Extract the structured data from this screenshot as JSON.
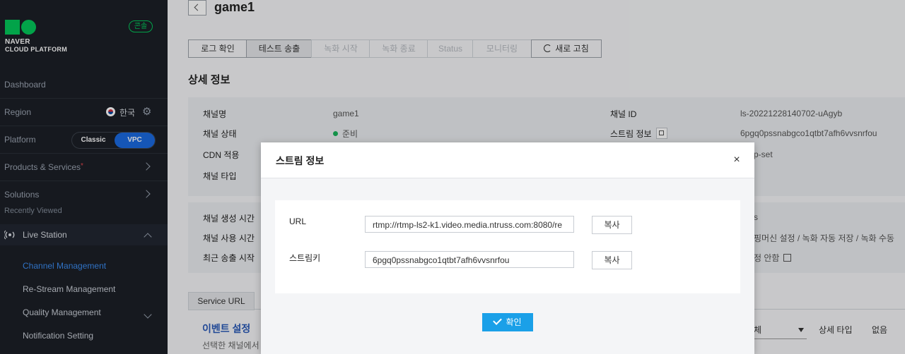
{
  "sidebar": {
    "logo_line1": "NAVER",
    "logo_line2": "CLOUD PLATFORM",
    "console_badge": "콘솔",
    "dashboard": "Dashboard",
    "region_label": "Region",
    "region_value": "한국",
    "platform_label": "Platform",
    "platform_classic": "Classic",
    "platform_vpc": "VPC",
    "products_services": "Products & Services",
    "solutions": "Solutions",
    "recently_viewed": "Recently Viewed",
    "live_station": "Live Station",
    "sub_items": [
      "Channel Management",
      "Re-Stream Management",
      "Quality Management",
      "Notification Setting"
    ]
  },
  "header": {
    "title": "game1"
  },
  "toolbar": {
    "buttons": [
      "로그 확인",
      "테스트 송출",
      "녹화 시작",
      "녹화 종료",
      "Status",
      "모니터링"
    ],
    "refresh": "새로 고침"
  },
  "detail": {
    "section_title": "상세 정보",
    "labels": [
      "채널명",
      "채널 상태",
      "CDN 적용",
      "채널 타입"
    ],
    "channel_name": "game1",
    "channel_status": "준비",
    "right_labels": [
      "채널 ID",
      "스트림 정보"
    ],
    "channel_id": "ls-20221228140702-uAgyb",
    "stream_info": "6pgq0pssnabgco1qtbt7afh6vvsnrfou",
    "partial_value": "p-set",
    "labels2": [
      "채널 생성 시간",
      "채널 사용 시간",
      "최근 송출 시작"
    ],
    "partial_s": "s",
    "partial_record": "핑머신 설정 / 녹화 자동 저장 / 녹화 수동",
    "partial_none": "정 안함"
  },
  "tabs": {
    "service_url": "Service URL"
  },
  "event": {
    "title": "이벤트 설정",
    "desc": "선택한 채널에서"
  },
  "filter": {
    "select": "체",
    "col1": "상세 타입",
    "col2": "없음"
  },
  "modal": {
    "title": "스트림 정보",
    "url_label": "URL",
    "url_value": "rtmp://rtmp-ls2-k1.video.media.ntruss.com:8080/re",
    "key_label": "스트림키",
    "key_value": "6pgq0pssnabgco1qtbt7afh6vvsnrfou",
    "copy_label": "복사",
    "ok_label": "확인",
    "close_glyph": "×"
  },
  "colors": {
    "brand_green": "#03c75a",
    "accent_blue": "#1a6ae0",
    "ok_button": "#1aa0e8",
    "sidebar_bg": "#1b1f27"
  }
}
